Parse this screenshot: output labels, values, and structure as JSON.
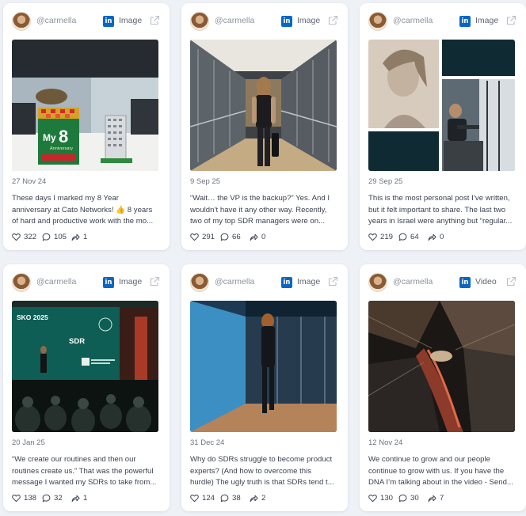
{
  "brand": {
    "linkedin_glyph": "in",
    "linkedin_color": "#0a66c2"
  },
  "icons": {
    "avatar": "profile-photo",
    "platform": "linkedin-icon",
    "open": "external-link-icon",
    "likes": "heart-icon",
    "comments": "comment-bubble-icon",
    "shares": "share-arrow-icon"
  },
  "posts": [
    {
      "handle": "@carmella",
      "type": "Image",
      "photo_text": {
        "brand": "My",
        "number": "8",
        "word": "Anniversary"
      },
      "date": "27 Nov 24",
      "text": "These days I marked my 8 Year anniversary at Cato Networks! 👍 8 years of hard and productive work with the mo...",
      "likes": "322",
      "comments": "105",
      "shares": "1"
    },
    {
      "handle": "@carmella",
      "type": "Image",
      "date": "9 Sep 25",
      "text": "“Wait… the VP is the backup?” Yes. And I wouldn’t have it any other way. Recently, two of my top SDR managers were on...",
      "likes": "291",
      "comments": "66",
      "shares": "0"
    },
    {
      "handle": "@carmella",
      "type": "Image",
      "date": "29 Sep 25",
      "text": "This is the most personal post I’ve written, but it felt important to share. The last two years in Israel were anything but “regular...",
      "likes": "219",
      "comments": "64",
      "shares": "0"
    },
    {
      "handle": "@carmella",
      "type": "Image",
      "photo_text": {
        "slide_title": "SKO 2025",
        "slide_heading": "SDR"
      },
      "date": "20 Jan 25",
      "text": "“We create our routines and then our routines create us.” That was the powerful message I wanted my SDRs to take from...",
      "likes": "138",
      "comments": "32",
      "shares": "1"
    },
    {
      "handle": "@carmella",
      "type": "Image",
      "date": "31 Dec 24",
      "text": "Why do SDRs struggle to become product experts? (And how to overcome this hurdle) The ugly truth is that SDRs tend t...",
      "likes": "124",
      "comments": "38",
      "shares": "2"
    },
    {
      "handle": "@carmella",
      "type": "Video",
      "date": "12 Nov 24",
      "text": "We continue to grow and our people continue to grow with us.  If you have the DNA I’m talking about in the video - Send...",
      "likes": "130",
      "comments": "30",
      "shares": "7"
    }
  ]
}
